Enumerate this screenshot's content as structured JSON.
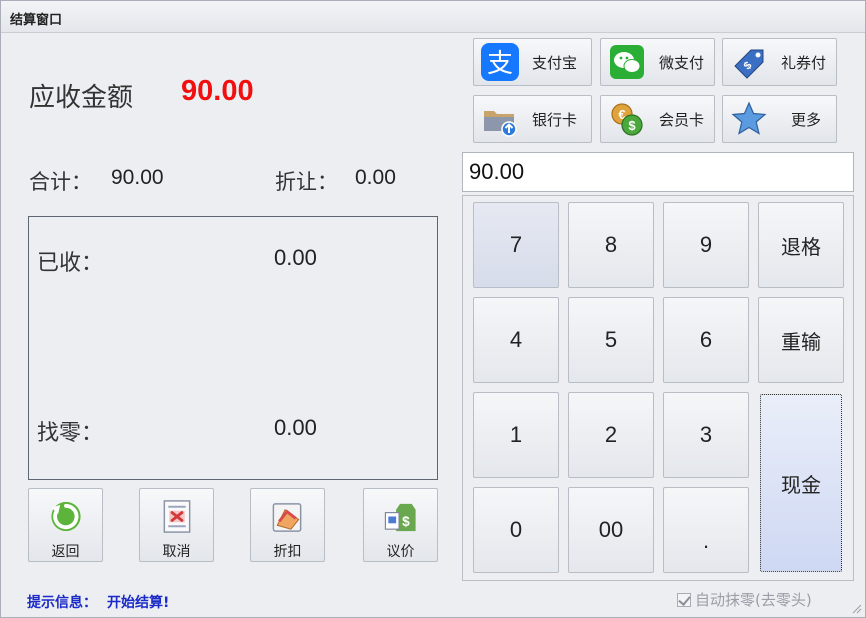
{
  "window": {
    "title": "结算窗口"
  },
  "summary": {
    "due_label": "应收金额",
    "due_value": "90.00",
    "total_label": "合计：",
    "total_value": "90.00",
    "discount_label": "折让：",
    "discount_value": "0.00",
    "received_label": "已收：",
    "received_value": "0.00",
    "change_label": "找零：",
    "change_value": "0.00"
  },
  "actions": {
    "back": "返回",
    "cancel": "取消",
    "discount": "折扣",
    "negotiate": "议价"
  },
  "status": {
    "hint_label": "提示信息：",
    "hint_value": "开始结算!"
  },
  "payment_methods": [
    {
      "label": "支付宝",
      "icon": "alipay-icon"
    },
    {
      "label": "微支付",
      "icon": "wechat-icon"
    },
    {
      "label": "礼券付",
      "icon": "coupon-tag-icon"
    },
    {
      "label": "银行卡",
      "icon": "folder-upload-icon"
    },
    {
      "label": "会员卡",
      "icon": "coins-icon"
    },
    {
      "label": "更多",
      "icon": "star-icon"
    }
  ],
  "amount_input": {
    "value": "90.00"
  },
  "keypad": {
    "k7": "7",
    "k8": "8",
    "k9": "9",
    "backspace": "退格",
    "k4": "4",
    "k5": "5",
    "k6": "6",
    "reset": "重输",
    "k1": "1",
    "k2": "2",
    "k3": "3",
    "cash": "现金",
    "k0": "0",
    "k00": "00",
    "dot": "."
  },
  "auto_round": {
    "label": "自动抹零(去零头)",
    "checked": true
  },
  "colors": {
    "due_value": "#f01010",
    "hint_text": "#1a2ac8",
    "alipay": "#1677ff",
    "wechat": "#2aae35"
  }
}
